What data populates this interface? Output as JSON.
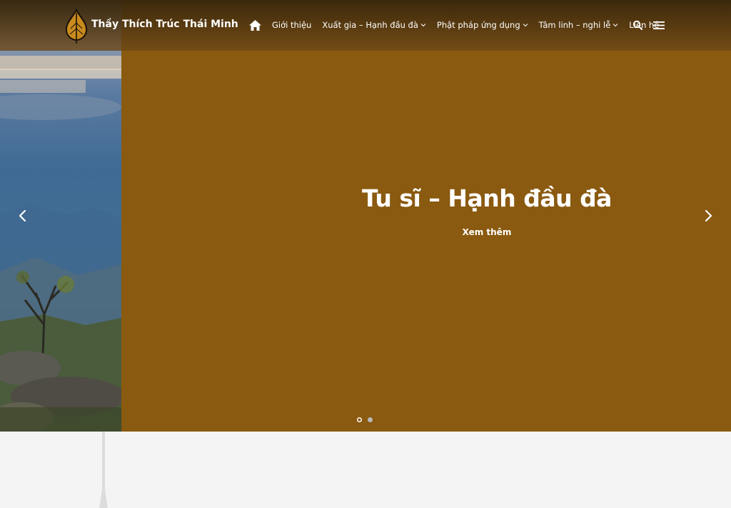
{
  "header": {
    "site_title": "Thầy Thích Trúc Thái Minh",
    "logo_icon": "bodhi-leaf-icon"
  },
  "nav": {
    "home_icon": "home-icon",
    "items": [
      {
        "label": "Giới thiệu",
        "has_dropdown": false
      },
      {
        "label": "Xuất gia – Hạnh đầu đà",
        "has_dropdown": true
      },
      {
        "label": "Phật pháp ứng dụng",
        "has_dropdown": true
      },
      {
        "label": "Tâm linh – nghi lễ",
        "has_dropdown": true
      },
      {
        "label": "Liên hệ",
        "has_dropdown": false
      }
    ],
    "search_icon": "search-icon",
    "menu_icon": "hamburger-menu-icon"
  },
  "slider": {
    "title": "Tu sĩ – Hạnh đầu đà",
    "link_label": "Xem thêm",
    "slide_count": 2,
    "active_slide": 1,
    "colors": {
      "panel": "#8a5a10",
      "header": "#4a3210"
    }
  }
}
